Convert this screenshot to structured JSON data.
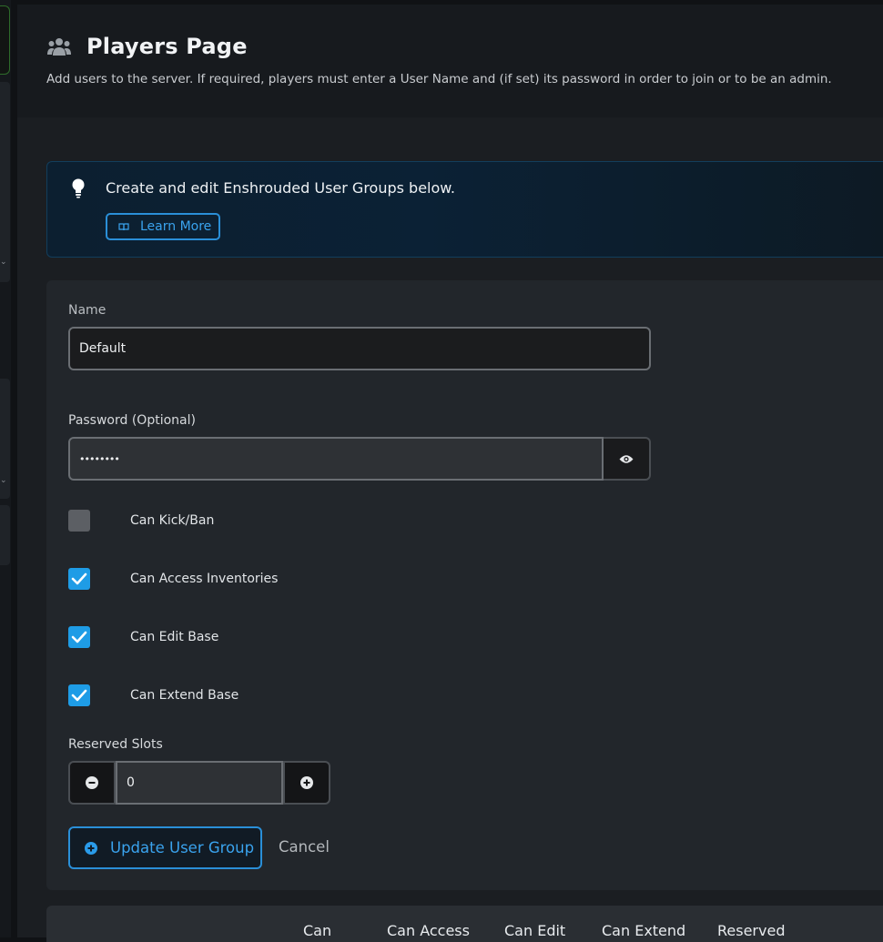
{
  "header": {
    "icon": "users-icon",
    "title": "Players Page",
    "description": "Add users to the server. If required, players must enter a User Name and (if set) its password in order to join or to be an admin."
  },
  "callout": {
    "icon": "lightbulb-icon",
    "text": "Create and edit Enshrouded User Groups below.",
    "learn_more": "Learn More"
  },
  "form": {
    "name_label": "Name",
    "name_value": "Default",
    "password_label": "Password (Optional)",
    "password_value": "••••••••",
    "permissions": [
      {
        "label": "Can Kick/Ban",
        "checked": false
      },
      {
        "label": "Can Access Inventories",
        "checked": true
      },
      {
        "label": "Can Edit Base",
        "checked": true
      },
      {
        "label": "Can Extend Base",
        "checked": true
      }
    ],
    "reserved_label": "Reserved Slots",
    "reserved_value": "0",
    "update_button": "Update User Group",
    "cancel_button": "Cancel"
  },
  "table": {
    "headers": [
      "Can",
      "Can Access",
      "Can Edit",
      "Can Extend",
      "Reserved"
    ]
  },
  "colors": {
    "accent": "#1e9ce6",
    "background": "#1b1e22"
  }
}
